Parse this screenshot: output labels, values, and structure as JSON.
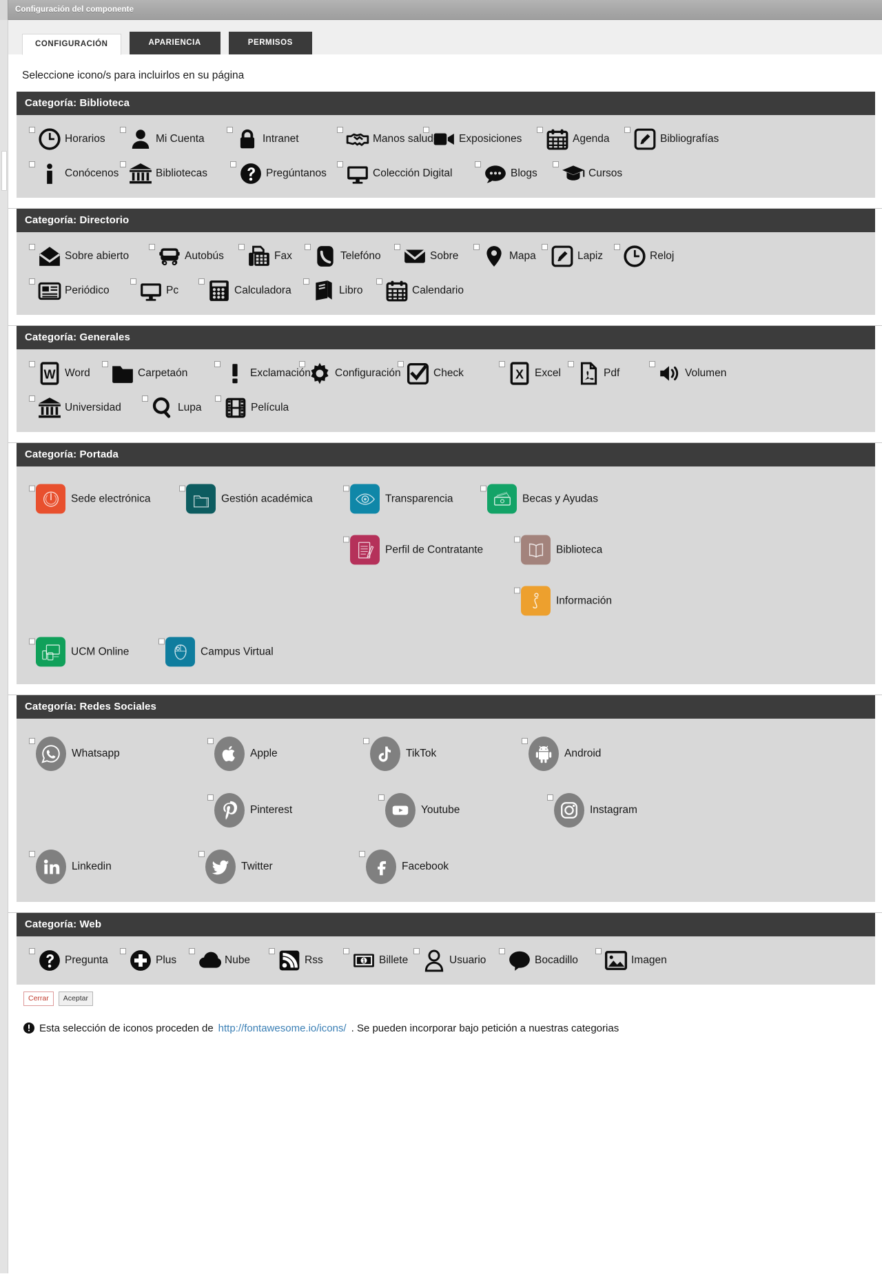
{
  "window": {
    "title": "Configuración del componente"
  },
  "tabs": [
    {
      "label": "CONFIGURACIÓN",
      "active": true
    },
    {
      "label": "APARIENCIA",
      "active": false
    },
    {
      "label": "PERMISOS",
      "active": false
    }
  ],
  "intro": "Seleccione icono/s para incluirlos en su página",
  "categories": [
    {
      "title": "Categoría: Biblioteca",
      "style": "mono",
      "rows": [
        [
          {
            "label": "Horarios",
            "icon": "clock-icon"
          },
          {
            "label": "Mi Cuenta",
            "icon": "user-icon"
          },
          {
            "label": "Intranet",
            "icon": "lock-icon"
          },
          {
            "label": "Manos saludo",
            "icon": "handshake-icon"
          },
          {
            "label": "Exposiciones",
            "icon": "video-camera-icon"
          },
          {
            "label": "Agenda",
            "icon": "calendar-alt-icon"
          },
          {
            "label": "Bibliografías",
            "icon": "pen-square-icon"
          }
        ],
        [
          {
            "label": "Conócenos",
            "icon": "info-icon"
          },
          {
            "label": "Bibliotecas",
            "icon": "university-icon"
          },
          {
            "label": "Pregúntanos",
            "icon": "question-circle-icon"
          },
          {
            "label": "Colección Digital",
            "icon": "desktop-icon"
          },
          {
            "label": "Blogs",
            "icon": "comment-dots-icon"
          },
          {
            "label": "Cursos",
            "icon": "graduation-cap-icon"
          }
        ]
      ]
    },
    {
      "title": "Categoría: Directorio",
      "style": "mono",
      "rows": [
        [
          {
            "label": "Sobre abierto",
            "icon": "envelope-open-icon"
          },
          {
            "label": "Autobús",
            "icon": "bus-icon"
          },
          {
            "label": "Fax",
            "icon": "fax-icon"
          },
          {
            "label": "Telefóno",
            "icon": "phone-icon"
          },
          {
            "label": "Sobre",
            "icon": "envelope-icon"
          },
          {
            "label": "Mapa",
            "icon": "map-marker-icon"
          },
          {
            "label": "Lapiz",
            "icon": "pen-square-icon"
          },
          {
            "label": "Reloj",
            "icon": "clock-icon"
          }
        ],
        [
          {
            "label": "Periódico",
            "icon": "newspaper-icon"
          },
          {
            "label": "Pc",
            "icon": "desktop-icon"
          },
          {
            "label": "Calculadora",
            "icon": "calculator-icon"
          },
          {
            "label": "Libro",
            "icon": "book-icon"
          },
          {
            "label": "Calendario",
            "icon": "calendar-alt-icon"
          }
        ]
      ]
    },
    {
      "title": "Categoría: Generales",
      "style": "mono",
      "rows": [
        [
          {
            "label": "Word",
            "icon": "file-word-icon"
          },
          {
            "label": "Carpetaón",
            "icon": "folder-icon"
          },
          {
            "label": "Exclamación",
            "icon": "exclamation-icon"
          },
          {
            "label": "Configuración",
            "icon": "cog-icon"
          },
          {
            "label": "Check",
            "icon": "check-square-icon"
          },
          {
            "label": "Excel",
            "icon": "file-excel-icon"
          },
          {
            "label": "Pdf",
            "icon": "file-pdf-icon"
          },
          {
            "label": "Volumen",
            "icon": "volume-up-icon"
          }
        ],
        [
          {
            "label": "Universidad",
            "icon": "university-icon"
          },
          {
            "label": "Lupa",
            "icon": "search-icon"
          },
          {
            "label": "Película",
            "icon": "film-icon"
          }
        ]
      ]
    },
    {
      "title": "Categoría: Portada",
      "style": "color",
      "rows": [
        [
          {
            "label": "Sede electrónica",
            "icon": "sede-electronica-icon",
            "color": "#e8502e"
          },
          {
            "label": "Gestión académica",
            "icon": "gestion-academica-icon",
            "color": "#0d5c60"
          },
          {
            "label": "Transparencia",
            "icon": "transparencia-icon",
            "color": "#0f87a8"
          },
          {
            "label": "Becas y Ayudas",
            "icon": "becas-ayudas-icon",
            "color": "#13a367"
          }
        ],
        [
          {
            "label": "Perfil de Contratante",
            "icon": "perfil-contratante-icon",
            "color": "#b5315a",
            "offset": 3
          },
          {
            "label": "Biblioteca",
            "icon": "biblioteca-portada-icon",
            "color": "#a3837c",
            "offset": 0
          }
        ],
        [
          {
            "label": "Información",
            "icon": "informacion-icon",
            "color": "#eda02e",
            "offset": 5
          }
        ],
        [
          {
            "label": "UCM Online",
            "icon": "ucm-online-icon",
            "color": "#10a05a"
          },
          {
            "label": "Campus Virtual",
            "icon": "campus-virtual-icon",
            "color": "#0f7d9e"
          }
        ]
      ]
    },
    {
      "title": "Categoría: Redes Sociales",
      "style": "social",
      "rows": [
        [
          {
            "label": "Whatsapp",
            "icon": "whatsapp-icon"
          },
          {
            "label": "Apple",
            "icon": "apple-icon"
          },
          {
            "label": "TikTok",
            "icon": "tiktok-icon"
          },
          {
            "label": "Android",
            "icon": "android-icon"
          }
        ],
        [
          {
            "label": "Pinterest",
            "icon": "pinterest-icon"
          },
          {
            "label": "Youtube",
            "icon": "youtube-icon"
          },
          {
            "label": "Instagram",
            "icon": "instagram-icon"
          }
        ],
        [
          {
            "label": "Linkedin",
            "icon": "linkedin-icon"
          },
          {
            "label": "Twitter",
            "icon": "twitter-icon"
          },
          {
            "label": "Facebook",
            "icon": "facebook-icon"
          }
        ]
      ]
    },
    {
      "title": "Categoría: Web",
      "style": "mono",
      "rows": [
        [
          {
            "label": "Pregunta",
            "icon": "question-circle-icon"
          },
          {
            "label": "Plus",
            "icon": "plus-circle-icon"
          },
          {
            "label": "Nube",
            "icon": "cloud-icon"
          },
          {
            "label": "Rss",
            "icon": "rss-square-icon"
          },
          {
            "label": "Billete",
            "icon": "money-bill-icon"
          },
          {
            "label": "Usuario",
            "icon": "user-outline-icon"
          },
          {
            "label": "Bocadillo",
            "icon": "comment-icon"
          },
          {
            "label": "Imagen",
            "icon": "image-icon"
          }
        ]
      ]
    }
  ],
  "footer": {
    "close_label": "Cerrar",
    "accept_label": "Aceptar",
    "note_prefix": "Esta selección de iconos proceden de ",
    "note_link": "http://fontawesome.io/icons/",
    "note_suffix": ". Se pueden incorporar bajo petición a nuestras categorias",
    "note_icon": "exclamation-circle-icon"
  },
  "colors": {
    "category_header_bg": "#3c3c3c",
    "category_body_bg": "#d8d8d8",
    "titlebar_bg": "#a8a8a8",
    "link": "#3a7fb5",
    "close_button_text": "#c0392b",
    "social_badge": "#808080"
  }
}
